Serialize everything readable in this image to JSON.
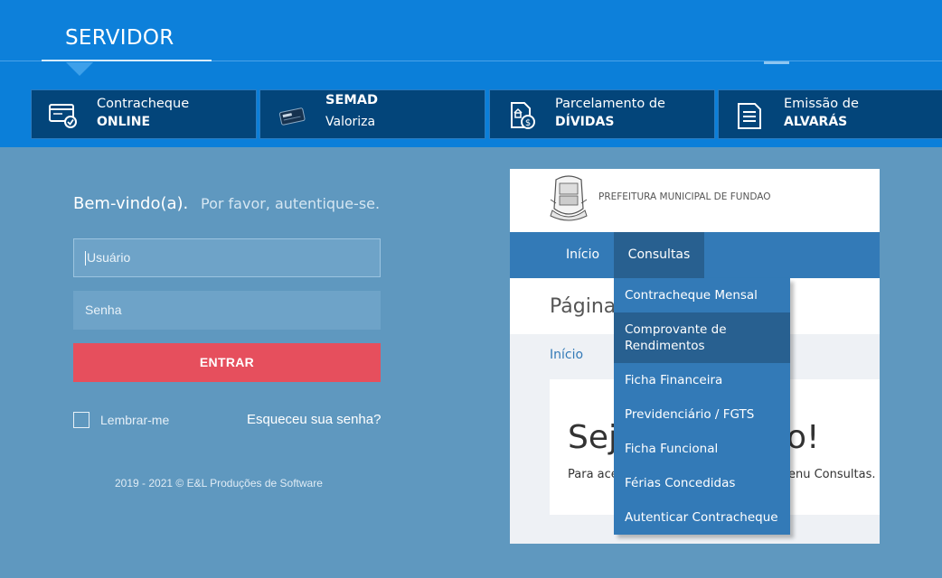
{
  "header": {
    "brand": "SERVIDOR",
    "tiles": [
      {
        "line1": "Contracheque",
        "line2": "ONLINE",
        "icon": "payslip-check-icon"
      },
      {
        "line1": "SEMAD",
        "line2": "Valoriza",
        "icon": "semad-card-icon"
      },
      {
        "line1": "Parcelamento de",
        "line2": "DÍVIDAS",
        "icon": "debt-document-icon"
      },
      {
        "line1": "Emissão de",
        "line2": "ALVARÁS",
        "icon": "permit-document-icon"
      }
    ]
  },
  "login": {
    "welcome": "Bem-vindo(a).",
    "subtitle": "Por favor, autentique-se.",
    "username_placeholder": "Usuário",
    "password_placeholder": "Senha",
    "submit_label": "ENTRAR",
    "remember_label": "Lembrar-me",
    "forgot_label": "Esqueceu sua senha?",
    "footer": "2019 - 2021 © E&L Produções de Software"
  },
  "portal": {
    "org_name": "PREFEITURA MUNICIPAL DE FUNDAO",
    "nav": [
      "Início",
      "Consultas"
    ],
    "page_title": "Página",
    "breadcrumb": "Início",
    "welcome_big_start": "Sej",
    "welcome_big_end": "o!",
    "welcome_small_start": "Para ace",
    "welcome_small_end": "enu Consultas."
  },
  "dropdown": {
    "items": [
      "Contracheque Mensal",
      "Comprovante de Rendimentos",
      "Ficha Financeira",
      "Previdenciário / FGTS",
      "Ficha Funcional",
      "Férias Concedidas",
      "Autenticar Contracheque"
    ],
    "active_index": 1
  }
}
